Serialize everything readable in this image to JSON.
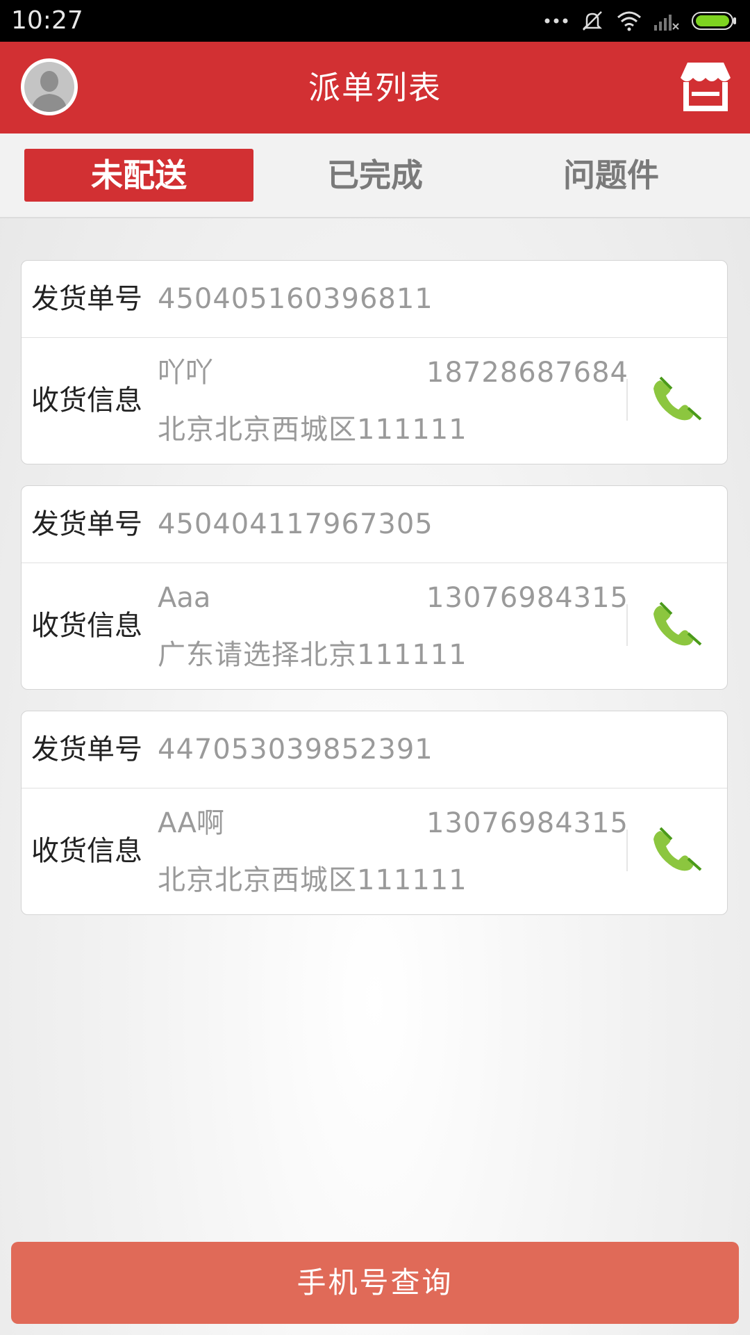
{
  "status_bar": {
    "time": "10:27"
  },
  "header": {
    "title": "派单列表",
    "avatar_icon": "user-avatar-icon",
    "store_icon": "store-icon"
  },
  "tabs": [
    {
      "label": "未配送",
      "active": true
    },
    {
      "label": "已完成",
      "active": false
    },
    {
      "label": "问题件",
      "active": false
    }
  ],
  "labels": {
    "order_number": "发货单号",
    "receiver_info": "收货信息"
  },
  "orders": [
    {
      "order_number": "450405160396811",
      "name": "吖吖",
      "phone": "18728687684",
      "address": "北京北京西城区111111"
    },
    {
      "order_number": "450404117967305",
      "name": "Aaa",
      "phone": "13076984315",
      "address": "广东请选择北京111111"
    },
    {
      "order_number": "447053039852391",
      "name": "AA啊",
      "phone": "13076984315",
      "address": "北京北京西城区111111"
    }
  ],
  "bottom_button": {
    "label": "手机号查询"
  },
  "colors": {
    "primary": "#d23033",
    "button": "#e06a58",
    "phone_icon": "#8cc63f"
  }
}
